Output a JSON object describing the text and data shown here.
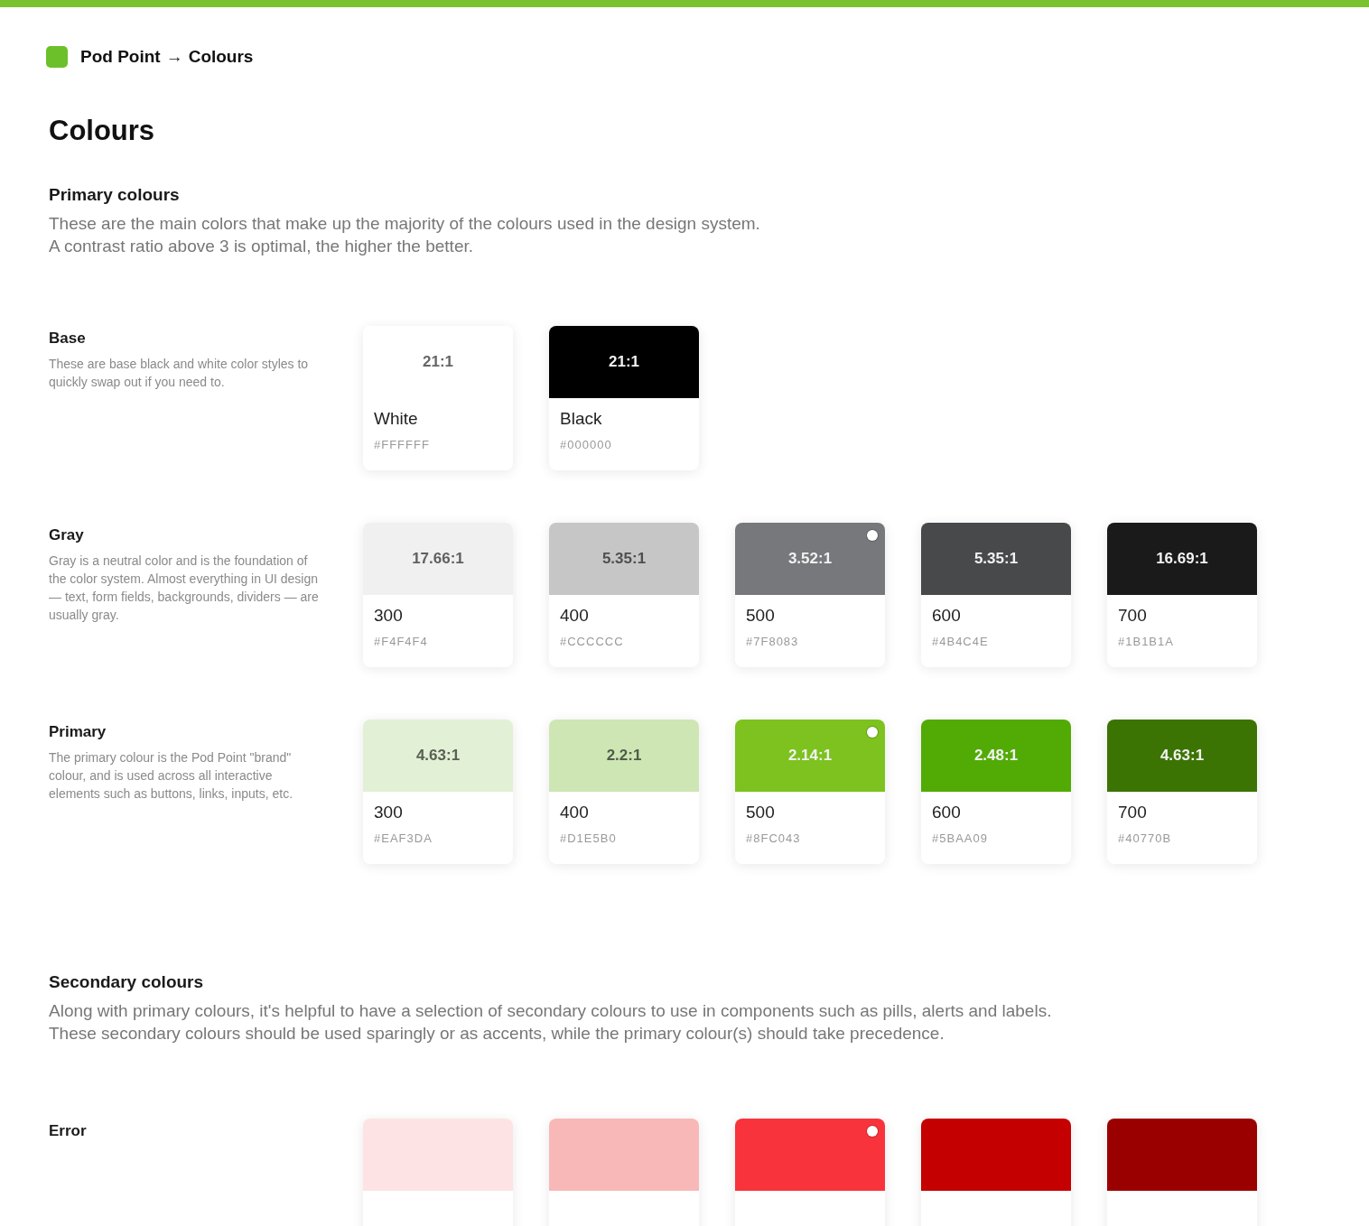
{
  "breadcrumb": {
    "project": "Pod Point",
    "arrow": "→",
    "page": "Colours"
  },
  "title": "Colours",
  "sections": [
    {
      "heading": "Primary colours",
      "description": [
        "These are the main colors that make up the majority of the colours used in the design system.",
        "A contrast ratio above 3 is optimal, the higher the better."
      ],
      "groups": [
        {
          "name": "Base",
          "description": "These are base black and white color styles to quickly swap out if you need to.",
          "swatches": [
            {
              "ratio": "21:1",
              "name": "White",
              "hex": "#FFFFFF",
              "color": "#ffffff",
              "marked": false
            },
            {
              "ratio": "21:1",
              "name": "Black",
              "hex": "#000000",
              "color": "#000000",
              "marked": false
            }
          ]
        },
        {
          "name": "Gray",
          "description": "Gray is a neutral color and is the foundation of the color system. Almost everything in UI design — text, form fields, backgrounds, dividers — are usually gray.",
          "swatches": [
            {
              "ratio": "17.66:1",
              "name": "300",
              "hex": "#F4F4F4",
              "color": "#f0f0f0",
              "marked": false
            },
            {
              "ratio": "5.35:1",
              "name": "400",
              "hex": "#CCCCCC",
              "color": "#c6c6c6",
              "marked": false
            },
            {
              "ratio": "3.52:1",
              "name": "500",
              "hex": "#7F8083",
              "color": "#77787b",
              "marked": true
            },
            {
              "ratio": "5.35:1",
              "name": "600",
              "hex": "#4B4C4E",
              "color": "#48494b",
              "marked": false
            },
            {
              "ratio": "16.69:1",
              "name": "700",
              "hex": "#1B1B1A",
              "color": "#1a1a1a",
              "marked": false
            }
          ]
        },
        {
          "name": "Primary",
          "description": "The primary colour is the Pod Point \"brand\" colour, and is used across all interactive elements such as buttons, links, inputs, etc.",
          "swatches": [
            {
              "ratio": "4.63:1",
              "name": "300",
              "hex": "#EAF3DA",
              "color": "#e2f0d5",
              "marked": false
            },
            {
              "ratio": "2.2:1",
              "name": "400",
              "hex": "#D1E5B0",
              "color": "#cde6b4",
              "marked": false
            },
            {
              "ratio": "2.14:1",
              "name": "500",
              "hex": "#8FC043",
              "color": "#7dc21e",
              "marked": true
            },
            {
              "ratio": "2.48:1",
              "name": "600",
              "hex": "#5BAA09",
              "color": "#52ab05",
              "marked": false
            },
            {
              "ratio": "4.63:1",
              "name": "700",
              "hex": "#40770B",
              "color": "#3c7404",
              "marked": false
            }
          ]
        }
      ]
    },
    {
      "heading": "Secondary colours",
      "description": [
        "Along with primary colours, it's helpful to have a selection of secondary colours to use in components such as pills, alerts and labels. These secondary colours should be used sparingly or as accents, while the primary colour(s) should take precedence."
      ],
      "groups": [
        {
          "name": "Error",
          "swatches": [
            {
              "color": "#fde3e3",
              "marked": false
            },
            {
              "color": "#f8b8b8",
              "marked": false
            },
            {
              "color": "#f8333c",
              "marked": true
            },
            {
              "color": "#c40000",
              "marked": false
            },
            {
              "color": "#9b0000",
              "marked": false
            }
          ]
        }
      ]
    }
  ]
}
